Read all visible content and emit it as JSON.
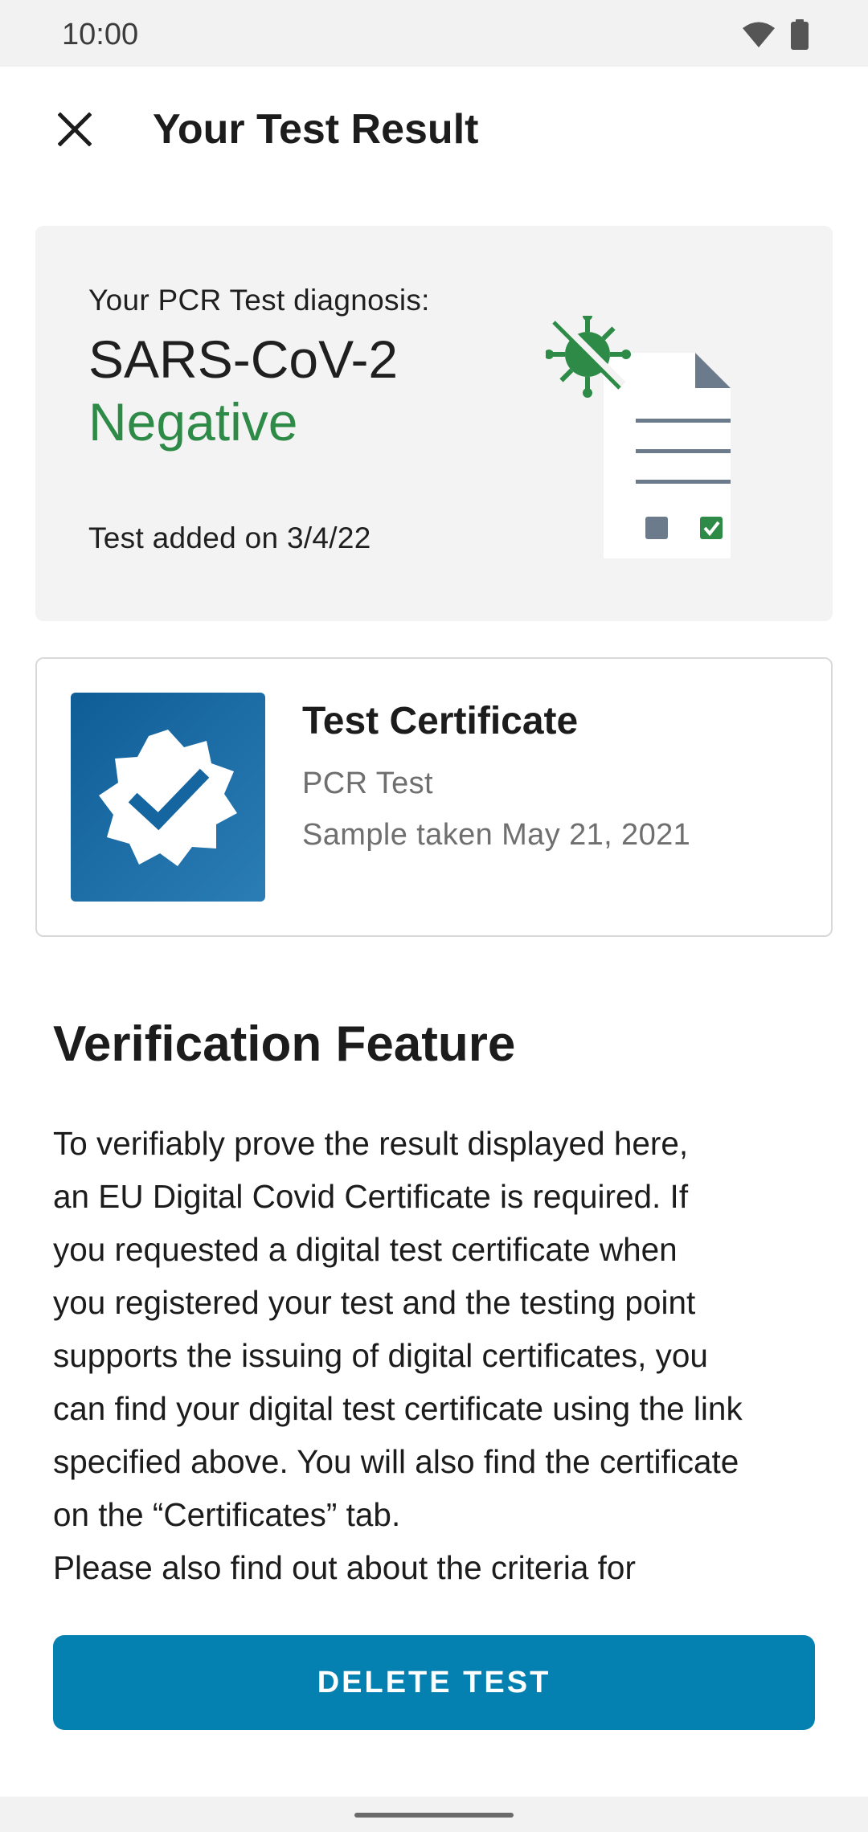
{
  "status_bar": {
    "time": "10:00",
    "icons": [
      "wifi-icon",
      "battery-icon"
    ]
  },
  "app_bar": {
    "title": "Your Test Result",
    "close_icon": "close-icon"
  },
  "result_card": {
    "diagnosis_label": "Your PCR Test diagnosis:",
    "diagnosis_name": "SARS-CoV-2",
    "diagnosis_result": "Negative",
    "date_text": "Test added on 3/4/22",
    "illustration_icon": "negative-test-document-icon"
  },
  "certificate_card": {
    "icon": "certificate-badge-icon",
    "title": "Test Certificate",
    "type": "PCR Test",
    "sample_taken": "Sample taken May 21, 2021"
  },
  "verification": {
    "title": "Verification Feature",
    "lines": [
      "To verifiably prove the result displayed here,",
      "an EU Digital Covid Certificate is required. If",
      "you requested a digital test certificate when",
      "you registered your test and the testing point",
      "supports the issuing of digital certificates, you",
      "can find your digital test certificate using the link",
      "specified above. You will also find the certificate",
      "on the “Certificates” tab.",
      "Please also find out about the criteria for"
    ]
  },
  "delete_button": {
    "label": "DELETE TEST"
  },
  "colors": {
    "negative_green": "#2e8b47",
    "button_blue": "#0481b1",
    "certificate_blue": "#0f5d97",
    "card_background": "#f3f3f3"
  }
}
